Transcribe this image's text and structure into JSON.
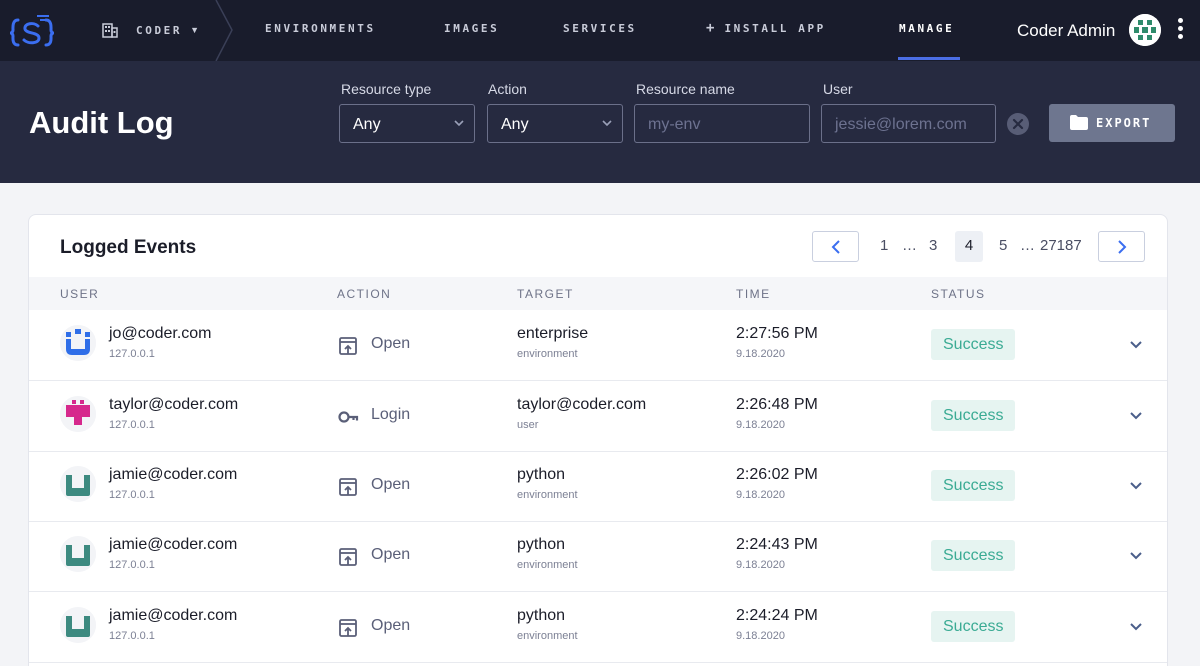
{
  "nav": {
    "org_label": "CODER",
    "links": [
      "ENVIRONMENTS",
      "IMAGES",
      "SERVICES",
      "INSTALL APP",
      "MANAGE"
    ],
    "active": "MANAGE",
    "user_name": "Coder Admin",
    "icons": [
      "coder-logo-icon",
      "building-icon",
      "chevron-down-icon",
      "plus-icon",
      "avatar",
      "more-vert-icon"
    ]
  },
  "header": {
    "title": "Audit Log",
    "filters": {
      "resource_type": {
        "label": "Resource type",
        "value": "Any"
      },
      "action": {
        "label": "Action",
        "value": "Any"
      },
      "resource_name": {
        "label": "Resource name",
        "placeholder": "my-env"
      },
      "user": {
        "label": "User",
        "placeholder": "jessie@lorem.com"
      }
    },
    "export_label": "EXPORT"
  },
  "events": {
    "title": "Logged Events",
    "pagination": {
      "pages": [
        "1",
        "…",
        "3",
        "4",
        "5",
        "…",
        "27187"
      ],
      "current": "4"
    },
    "columns": [
      "USER",
      "ACTION",
      "TARGET",
      "TIME",
      "STATUS"
    ],
    "rows": [
      {
        "user": "jo@coder.com",
        "ip": "127.0.0.1",
        "action": "Open",
        "target": "enterprise",
        "target_type": "environment",
        "time": "2:27:56 PM",
        "date": "9.18.2020",
        "status": "Success"
      },
      {
        "user": "taylor@coder.com",
        "ip": "127.0.0.1",
        "action": "Login",
        "target": "taylor@coder.com",
        "target_type": "user",
        "time": "2:26:48 PM",
        "date": "9.18.2020",
        "status": "Success"
      },
      {
        "user": "jamie@coder.com",
        "ip": "127.0.0.1",
        "action": "Open",
        "target": "python",
        "target_type": "environment",
        "time": "2:26:02 PM",
        "date": "9.18.2020",
        "status": "Success"
      },
      {
        "user": "jamie@coder.com",
        "ip": "127.0.0.1",
        "action": "Open",
        "target": "python",
        "target_type": "environment",
        "time": "2:24:43 PM",
        "date": "9.18.2020",
        "status": "Success"
      },
      {
        "user": "jamie@coder.com",
        "ip": "127.0.0.1",
        "action": "Open",
        "target": "python",
        "target_type": "environment",
        "time": "2:24:24 PM",
        "date": "9.18.2020",
        "status": "Success"
      }
    ]
  },
  "colors": {
    "nav_bg": "#191c2c",
    "header_bg": "#262a40",
    "accent": "#4b6ee5",
    "success_text": "#3bab94",
    "success_bg": "#e6f4f1"
  }
}
